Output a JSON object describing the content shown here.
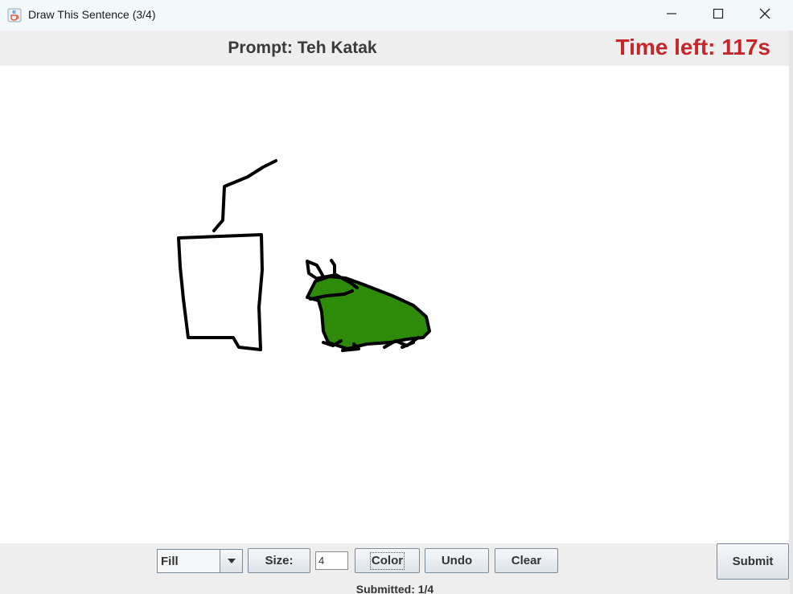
{
  "window": {
    "title": "Draw This Sentence (3/4)",
    "app_icon": "java-cup-icon",
    "controls": [
      "minimize-icon",
      "maximize-icon",
      "close-icon"
    ]
  },
  "header": {
    "prompt": "Prompt: Teh Katak",
    "timer": "Time left: 117s",
    "timer_color": "#c4262a"
  },
  "canvas": {
    "drawings": [
      {
        "name": "cup-with-straw",
        "stroke": "#000000",
        "fill": "none"
      },
      {
        "name": "frog",
        "stroke": "#000000",
        "fill": "#2e8b0a"
      }
    ]
  },
  "toolbar": {
    "mode_select": {
      "value": "Fill"
    },
    "size_label": "Size:",
    "size_value": "4",
    "color_label": "Color",
    "undo_label": "Undo",
    "clear_label": "Clear",
    "submit_label": "Submit",
    "status": "Submitted: 1/4"
  }
}
